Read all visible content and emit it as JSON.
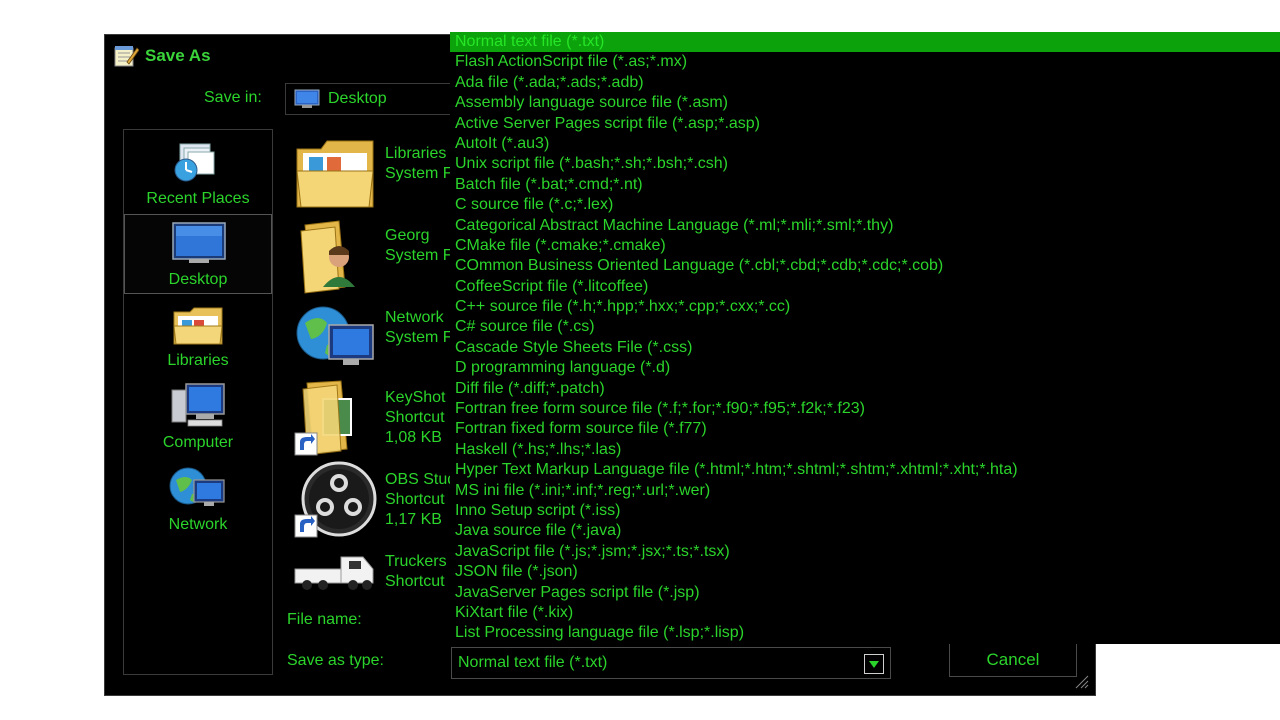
{
  "dialog": {
    "title": "Save As",
    "save_in_label": "Save in:",
    "save_in_value": "Desktop",
    "file_name_label": "File name:",
    "save_as_type_label": "Save as type:",
    "save_as_type_value": "Normal text file (*.txt)",
    "cancel_label": "Cancel"
  },
  "places": [
    {
      "label": "Recent Places",
      "icon": "recent-places-icon"
    },
    {
      "label": "Desktop",
      "icon": "desktop-icon",
      "selected": true
    },
    {
      "label": "Libraries",
      "icon": "libraries-icon"
    },
    {
      "label": "Computer",
      "icon": "computer-icon"
    },
    {
      "label": "Network",
      "icon": "network-icon"
    }
  ],
  "files": [
    {
      "line1": "Libraries",
      "line2": "System Folder",
      "line3": "",
      "icon": "libraries-folder-icon"
    },
    {
      "line1": "Georg",
      "line2": "System Folder",
      "line3": "",
      "icon": "user-folder-icon"
    },
    {
      "line1": "Network",
      "line2": "System Folder",
      "line3": "",
      "icon": "network-globe-icon"
    },
    {
      "line1": "KeyShot",
      "line2": "Shortcut",
      "line3": "1,08 KB",
      "icon": "keyshot-shortcut-icon"
    },
    {
      "line1": "OBS Studio",
      "line2": "Shortcut",
      "line3": "1,17 KB",
      "icon": "obs-shortcut-icon"
    },
    {
      "line1": "Truckers",
      "line2": "Shortcut",
      "line3": "",
      "icon": "truck-shortcut-icon"
    }
  ],
  "file_types": [
    "Normal text file (*.txt)",
    "Flash ActionScript file (*.as;*.mx)",
    "Ada file (*.ada;*.ads;*.adb)",
    "Assembly language source file (*.asm)",
    "Active Server Pages script file (*.asp;*.asp)",
    "AutoIt (*.au3)",
    "Unix script file (*.bash;*.sh;*.bsh;*.csh)",
    "Batch file (*.bat;*.cmd;*.nt)",
    "C source file (*.c;*.lex)",
    "Categorical Abstract Machine Language (*.ml;*.mli;*.sml;*.thy)",
    "CMake file (*.cmake;*.cmake)",
    "COmmon Business Oriented Language (*.cbl;*.cbd;*.cdb;*.cdc;*.cob)",
    "CoffeeScript file (*.litcoffee)",
    "C++ source file (*.h;*.hpp;*.hxx;*.cpp;*.cxx;*.cc)",
    "C# source file (*.cs)",
    "Cascade Style Sheets File (*.css)",
    "D programming language (*.d)",
    "Diff file (*.diff;*.patch)",
    "Fortran free form source file (*.f;*.for;*.f90;*.f95;*.f2k;*.f23)",
    "Fortran fixed form source file (*.f77)",
    "Haskell (*.hs;*.lhs;*.las)",
    "Hyper Text Markup Language file (*.html;*.htm;*.shtml;*.shtm;*.xhtml;*.xht;*.hta)",
    "MS ini file (*.ini;*.inf;*.reg;*.url;*.wer)",
    "Inno Setup script (*.iss)",
    "Java source file (*.java)",
    "JavaScript file (*.js;*.jsm;*.jsx;*.ts;*.tsx)",
    "JSON file (*.json)",
    "JavaServer Pages script file (*.jsp)",
    "KiXtart file (*.kix)",
    "List Processing language file (*.lsp;*.lisp)"
  ],
  "selected_type_index": 0,
  "colors": {
    "text": "#2bd42b",
    "highlight": "#0ba20b",
    "background": "#000000"
  }
}
